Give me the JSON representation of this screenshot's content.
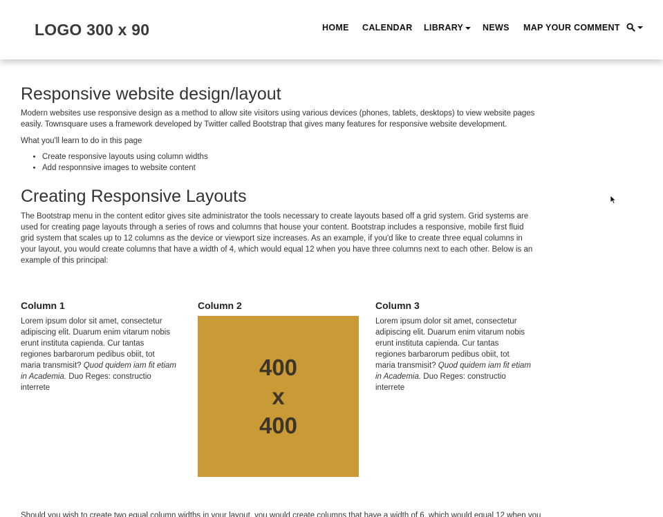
{
  "header": {
    "logo": "LOGO 300 x 90",
    "nav": [
      {
        "label": "HOME"
      },
      {
        "label": "CALENDAR"
      },
      {
        "label": "LIBRARY"
      },
      {
        "label": "NEWS"
      },
      {
        "label": "MAP YOUR COMMENT"
      }
    ],
    "search_icon": "search-icon"
  },
  "main": {
    "heading1": "Responsive website design/layout",
    "intro": "Modern websites use responsive design as a method to allow site visitors using various devices (phones, tablets, desktops) to view website pages easily. Townsquare uses a framework developed by Twitter called Bootstrap that gives many features for responsive website development.",
    "learn_intro": "What you'll learn to do in this page",
    "learn_items": [
      "Create responsive layouts using column widths",
      "Add responnsive images to website content"
    ],
    "heading2": "Creating Responsive Layouts",
    "grid_paragraph": "The Bootstrap menu in the content editor gives site administrator the tools necessary to create layouts based off a grid system. Grid systems are used for creating page layouts through a series of rows and columns that house your content. Bootstrap includes a responsive, mobile first fluid grid system that scales up to 12 columns as the device or viewport size increases. As an example, if you'd like to create three equal columns in your layout, you would create columns that have a width of 4, which would equal 12 when you have three columns next to each other. Below is an example of this principal:",
    "columns": [
      {
        "title": "Column 1",
        "text_start": "Lorem ipsum dolor sit amet, consectetur adipiscing elit. Duarum enim vitarum nobis erunt instituta capienda. Cur tantas regiones barbarorum pedibus obiit, tot maria transmisit? ",
        "text_italic": "Quod quidem iam fit etiam in Academia.",
        "text_end": " Duo Reges: constructio interrete"
      },
      {
        "title": "Column 2",
        "placeholder_lines": [
          "400",
          "x",
          "400"
        ],
        "placeholder_color": "#c99a36"
      },
      {
        "title": "Column 3",
        "text_start": "Lorem ipsum dolor sit amet, consectetur adipiscing elit. Duarum enim vitarum nobis erunt instituta capienda. Cur tantas regiones barbarorum pedibus obiit, tot maria transmisit? ",
        "text_italic": "Quod quidem iam fit etiam in Academia.",
        "text_end": " Duo Reges: constructio interrete"
      }
    ],
    "bottom_paragraph": "Should you wish to create two equal column widths in your layout, you would create columns that have a width of 6, which would equal 12 when you"
  }
}
